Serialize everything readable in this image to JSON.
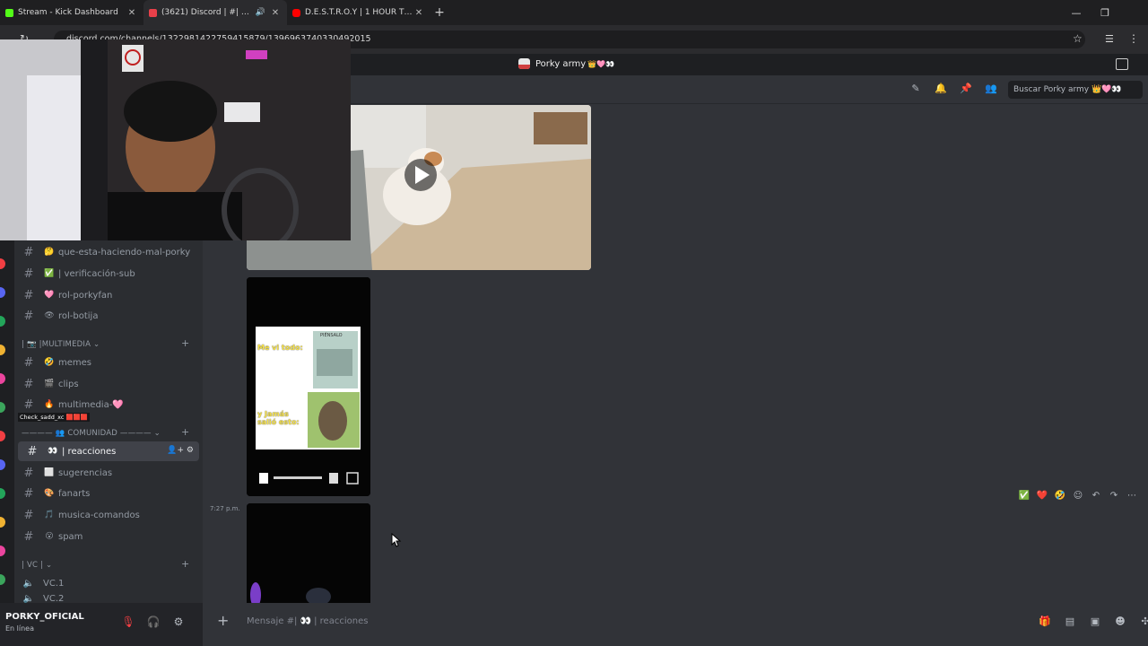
{
  "browser": {
    "tabs": [
      {
        "title": "Stream - Kick Dashboard",
        "favicon_color": "#53fc18"
      },
      {
        "title": "(3621) Discord | #| 👀 |reacc",
        "favicon_color": "#e8404a",
        "active": true
      },
      {
        "title": "D.E.S.T.R.O.Y | 1 HOUR TRY HAR",
        "favicon_color": "#ff0000"
      }
    ],
    "url": "discord.com/channels/1322981422759415879/1396963740330492015"
  },
  "server": {
    "name": "Porky army",
    "name_emoji": "👑🩷👀"
  },
  "header": {
    "search_placeholder": "Buscar Porky army 👑🩷👀"
  },
  "sidebar": {
    "channels_top": [
      {
        "emoji": "🤔",
        "label": "que-esta-haciendo-mal-porky"
      },
      {
        "emoji": "✅",
        "label": "| verificación-sub"
      },
      {
        "emoji": "🩷",
        "label": "rol-porkyfan"
      },
      {
        "emoji": "👁",
        "label": "rol-botija"
      }
    ],
    "category_multimedia": "| 📷 |MULTIMEDIA ⌄",
    "channels_multimedia": [
      {
        "emoji": "🤣",
        "label": "memes"
      },
      {
        "emoji": "🎬",
        "label": "clips"
      },
      {
        "emoji": "🔥",
        "label": "multimedia-🩷"
      }
    ],
    "category_comunidad": "———— 👥 COMUNIDAD ———— ⌄",
    "channels_comunidad": [
      {
        "emoji": "👀",
        "label": "| reacciones",
        "active": true
      },
      {
        "emoji": "⬜",
        "label": "sugerencias"
      },
      {
        "emoji": "🎨",
        "label": "fanarts"
      },
      {
        "emoji": "🎵",
        "label": "musica-comandos"
      },
      {
        "emoji": "😮",
        "label": "spam"
      }
    ],
    "category_vc": "| VC | ⌄",
    "voice_channels": [
      {
        "label": "VC.1"
      },
      {
        "label": "VC.2"
      }
    ],
    "overlay_label": "Check_sadd_xc 🟥🟥🟥"
  },
  "user": {
    "name": "PORKY_OFICIAL",
    "status": "En línea"
  },
  "chat": {
    "meme_top_text": "Me vi todo:",
    "meme_top_caption": "PIÉNSALO",
    "meme_bottom_text": "y Jamás salió esto:",
    "timestamp": "7:27 p.m.",
    "composer_placeholder": "Mensaje #| 👀 | reacciones",
    "reactions": [
      "✅",
      "❤️",
      "🤣"
    ]
  },
  "colors": {
    "app_bg": "#313338",
    "sidebar_bg": "#2b2d31",
    "titlebar_bg": "#1e1f22",
    "accent_red": "#f23f43"
  }
}
